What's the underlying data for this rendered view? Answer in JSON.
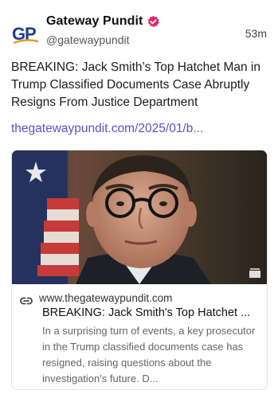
{
  "author": {
    "name": "Gateway Pundit",
    "handle": "@gatewaypundit",
    "avatar_text": "GP",
    "verified_color": "#e3256b"
  },
  "post": {
    "time": "53m",
    "text": "BREAKING: Jack Smith’s Top Hatchet Man in Trump Classified Documents Case Abruptly Resigns From Justice Department",
    "link_text": "thegatewaypundit.com/2025/01/b...",
    "link_color": "#5a52d5"
  },
  "card": {
    "domain": "www.thegatewaypundit.com",
    "title": "BREAKING: Jack Smith's Top Hatchet ...",
    "description": "In a surprising turn of events, a key prosecutor in the Trump classified documents case has resigned, raising questions about the investigation's future. D...",
    "image_alt": "portrait of a man with glasses in front of an American flag"
  },
  "icons": {
    "verified": "verified-badge-icon",
    "link": "link-icon",
    "image_overlay": "gallery-icon"
  }
}
